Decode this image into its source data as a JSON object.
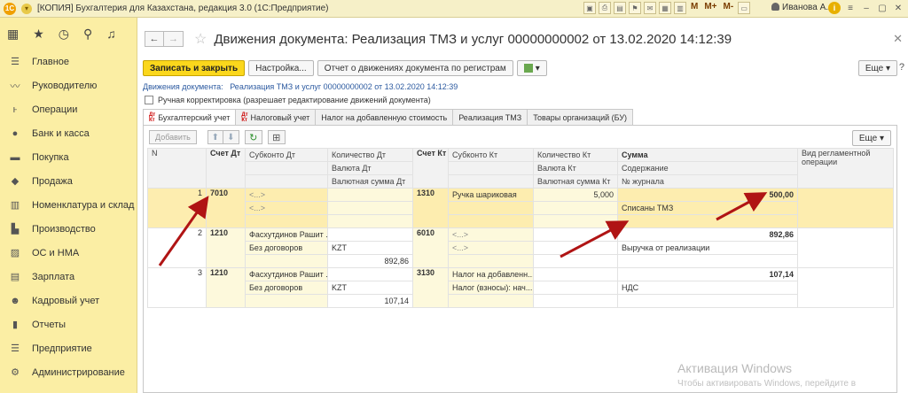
{
  "titlebar": {
    "logo": "1С",
    "title": "[КОПИЯ] Бухгалтерия для Казахстана, редакция 3.0  (1С:Предприятие)",
    "memory_buttons": [
      "M",
      "M+",
      "M-"
    ],
    "user": "Иванова А.А."
  },
  "sidebar": {
    "items": [
      {
        "label": "Главное",
        "icon": "menu-icon"
      },
      {
        "label": "Руководителю",
        "icon": "chart-line-icon"
      },
      {
        "label": "Операции",
        "icon": "operations-icon"
      },
      {
        "label": "Банк и касса",
        "icon": "coin-icon"
      },
      {
        "label": "Покупка",
        "icon": "cart-icon"
      },
      {
        "label": "Продажа",
        "icon": "bag-icon"
      },
      {
        "label": "Номенклатура и склад",
        "icon": "boxes-icon"
      },
      {
        "label": "Производство",
        "icon": "factory-icon"
      },
      {
        "label": "ОС и НМА",
        "icon": "assets-icon"
      },
      {
        "label": "Зарплата",
        "icon": "salary-icon"
      },
      {
        "label": "Кадровый учет",
        "icon": "people-icon"
      },
      {
        "label": "Отчеты",
        "icon": "reports-icon"
      },
      {
        "label": "Предприятие",
        "icon": "enterprise-icon"
      },
      {
        "label": "Администрирование",
        "icon": "gear-icon"
      }
    ]
  },
  "header": {
    "title": "Движения документа: Реализация ТМЗ и услуг 00000000002 от 13.02.2020 14:12:39"
  },
  "toolbar": {
    "save_close": "Записать и закрыть",
    "settings": "Настройка...",
    "report": "Отчет о движениях документа по регистрам",
    "more": "Еще"
  },
  "doc_line": {
    "prefix": "Движения документа:",
    "link": "Реализация ТМЗ и услуг 00000000002 от 13.02.2020 14:12:39"
  },
  "manual": {
    "label": "Ручная корректировка (разрешает редактирование движений документа)"
  },
  "tabs": [
    {
      "label": "Бухгалтерский учет",
      "active": true
    },
    {
      "label": "Налоговый учет",
      "active": false
    },
    {
      "label": "Налог на добавленную стоимость",
      "active": false
    },
    {
      "label": "Реализация ТМЗ",
      "active": false
    },
    {
      "label": "Товары организаций (БУ)",
      "active": false
    }
  ],
  "tab_icon_text": {
    "top": "Дт",
    "bottom": "Кт"
  },
  "panel": {
    "add": "Добавить",
    "more": "Еще"
  },
  "columns": {
    "n": "N",
    "acc_dt": "Счет Дт",
    "subkonto_dt": "Субконто Дт",
    "qty_dt": "Количество Дт",
    "cur_dt": "Валюта Дт",
    "cursum_dt": "Валютная сумма Дт",
    "acc_kt": "Счет Кт",
    "subkonto_kt": "Субконто Кт",
    "qty_kt": "Количество Кт",
    "cur_kt": "Валюта Кт",
    "cursum_kt": "Валютная сумма Кт",
    "sum": "Сумма",
    "content": "Содержание",
    "journal": "№ журнала",
    "op_type": "Вид регламентной операции"
  },
  "rows": [
    {
      "n": "1",
      "acc_dt": "7010",
      "sub_dt_1": "<...>",
      "sub_dt_2": "<...>",
      "qty_dt": "",
      "cur_dt": "",
      "cursum_dt": "",
      "acc_kt": "1310",
      "sub_kt_1": "Ручка шариковая",
      "sub_kt_2": "",
      "qty_kt": "5,000",
      "sum": "500,00",
      "content": "Списаны ТМЗ"
    },
    {
      "n": "2",
      "acc_dt": "1210",
      "sub_dt_1": "Фасхутдинов Рашит ...",
      "sub_dt_2": "Без договоров",
      "qty_dt": "",
      "cur_dt": "KZT",
      "cursum_dt": "892,86",
      "acc_kt": "6010",
      "sub_kt_1": "<...>",
      "sub_kt_2": "<...>",
      "qty_kt": "",
      "sum": "892,86",
      "content": "Выручка от реализации"
    },
    {
      "n": "3",
      "acc_dt": "1210",
      "sub_dt_1": "Фасхутдинов Рашит ...",
      "sub_dt_2": "Без договоров",
      "qty_dt": "",
      "cur_dt": "KZT",
      "cursum_dt": "107,14",
      "acc_kt": "3130",
      "sub_kt_1": "Налог на добавленн...",
      "sub_kt_2": "Налог (взносы): нач...",
      "qty_kt": "",
      "sum": "107,14",
      "content": "НДС"
    }
  ],
  "watermark": {
    "line1": "Активация Windows",
    "line2": "Чтобы активировать Windows, перейдите в"
  },
  "colors": {
    "accent": "#fbd71c",
    "sidebar": "#fbeea4",
    "arrow": "#b01414",
    "link": "#2c5aa0"
  }
}
